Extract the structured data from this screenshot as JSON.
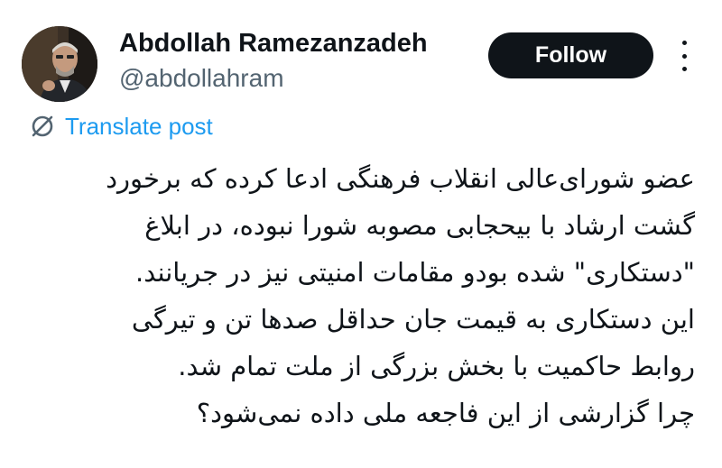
{
  "author": {
    "display_name": "Abdollah Ramezanzadeh",
    "handle": "@abdollahram",
    "avatar_icon": "profile-photo"
  },
  "actions": {
    "follow_label": "Follow",
    "more_icon": "more-vertical-icon"
  },
  "translate": {
    "icon": "globe-slash-icon",
    "label": "Translate post"
  },
  "post": {
    "direction": "rtl",
    "lines": [
      "عضو شورای‌عالی انقلاب فرهنگی ادعا کرده که برخورد",
      "گشت ارشاد با  بیحجابی مصوبه شورا نبوده، در ابلاغ",
      "\"دستکاری\" شده بودو مقامات امنیتی نیز در جریانند.",
      "این دستکاری به قیمت جان حداقل صدها تن و تیرگی",
      "روابط حاکمیت با بخش بزرگی از ملت تمام شد.",
      "چرا گزارشی از این فاجعه ملی داده نمی‌شود؟"
    ]
  },
  "colors": {
    "text_primary": "#0f1419",
    "text_secondary": "#536471",
    "link_blue": "#1d9bf0",
    "button_bg": "#0f1419",
    "button_text": "#ffffff"
  }
}
